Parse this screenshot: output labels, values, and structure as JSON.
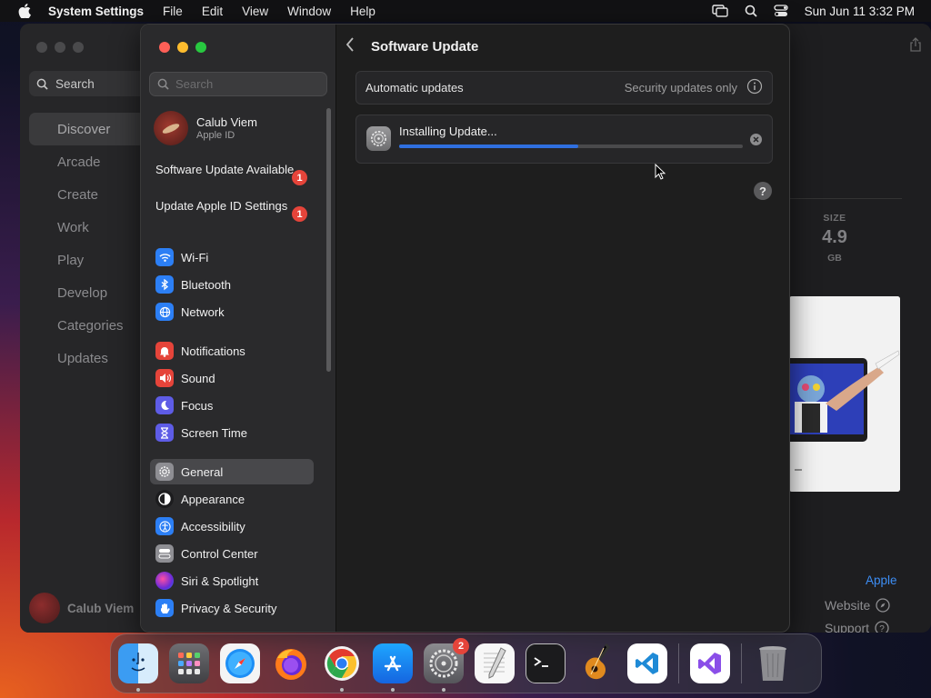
{
  "menubar": {
    "app_name": "System Settings",
    "items": [
      "File",
      "Edit",
      "View",
      "Window",
      "Help"
    ],
    "clock": "Sun Jun 11  3:32 PM"
  },
  "appstore": {
    "search_label": "Search",
    "nav": [
      "Discover",
      "Arcade",
      "Create",
      "Work",
      "Play",
      "Develop",
      "Categories",
      "Updates"
    ],
    "active_nav": "Discover",
    "user_name": "Calub Viem",
    "size_label": "SIZE",
    "size_value": "4.9",
    "size_unit": "GB",
    "developer_link": "Apple",
    "website_label": "Website",
    "support_label": "Support"
  },
  "settings": {
    "search_placeholder": "Search",
    "user": {
      "name": "Calub Viem",
      "subtitle": "Apple ID"
    },
    "alerts": [
      {
        "label": "Software Update Available",
        "badge": "1"
      },
      {
        "label": "Update Apple ID Settings",
        "badge": "1"
      }
    ],
    "sidebar_groups": [
      [
        {
          "label": "Wi-Fi",
          "icon": "wifi-icon",
          "color": "#2c7ff5"
        },
        {
          "label": "Bluetooth",
          "icon": "bluetooth-icon",
          "color": "#2c7ff5"
        },
        {
          "label": "Network",
          "icon": "globe-icon",
          "color": "#2c7ff5"
        }
      ],
      [
        {
          "label": "Notifications",
          "icon": "bell-icon",
          "color": "#e5443a"
        },
        {
          "label": "Sound",
          "icon": "speaker-icon",
          "color": "#e5443a"
        },
        {
          "label": "Focus",
          "icon": "moon-icon",
          "color": "#5e5ce6"
        },
        {
          "label": "Screen Time",
          "icon": "hourglass-icon",
          "color": "#5e5ce6"
        }
      ],
      [
        {
          "label": "General",
          "icon": "gear-icon",
          "color": "#8e8e93",
          "active": true
        },
        {
          "label": "Appearance",
          "icon": "appearance-icon",
          "color": "#1c1c1e"
        },
        {
          "label": "Accessibility",
          "icon": "accessibility-icon",
          "color": "#2c7ff5"
        },
        {
          "label": "Control Center",
          "icon": "control-center-icon",
          "color": "#8e8e93"
        },
        {
          "label": "Siri & Spotlight",
          "icon": "siri-icon",
          "color": "#6a2bd9"
        },
        {
          "label": "Privacy & Security",
          "icon": "hand-icon",
          "color": "#2c7ff5"
        }
      ]
    ],
    "page_title": "Software Update",
    "automatic_updates_label": "Automatic updates",
    "automatic_updates_value": "Security updates only",
    "installing_label": "Installing Update...",
    "install_progress": 0.52,
    "help_label": "?"
  },
  "dock": {
    "apps": [
      {
        "name": "Finder",
        "running": true
      },
      {
        "name": "Launchpad",
        "running": false
      },
      {
        "name": "Safari",
        "running": false
      },
      {
        "name": "Firefox",
        "running": false
      },
      {
        "name": "Chrome",
        "running": true
      },
      {
        "name": "App Store",
        "running": true
      },
      {
        "name": "System Settings",
        "running": true,
        "badge": "2"
      },
      {
        "name": "TextEdit",
        "running": false
      },
      {
        "name": "Terminal",
        "running": false
      },
      {
        "name": "GarageBand",
        "running": false
      },
      {
        "name": "Visual Studio Code",
        "running": false
      },
      {
        "name": "Visual Studio",
        "running": false
      },
      {
        "name": "Trash",
        "running": false
      }
    ]
  }
}
